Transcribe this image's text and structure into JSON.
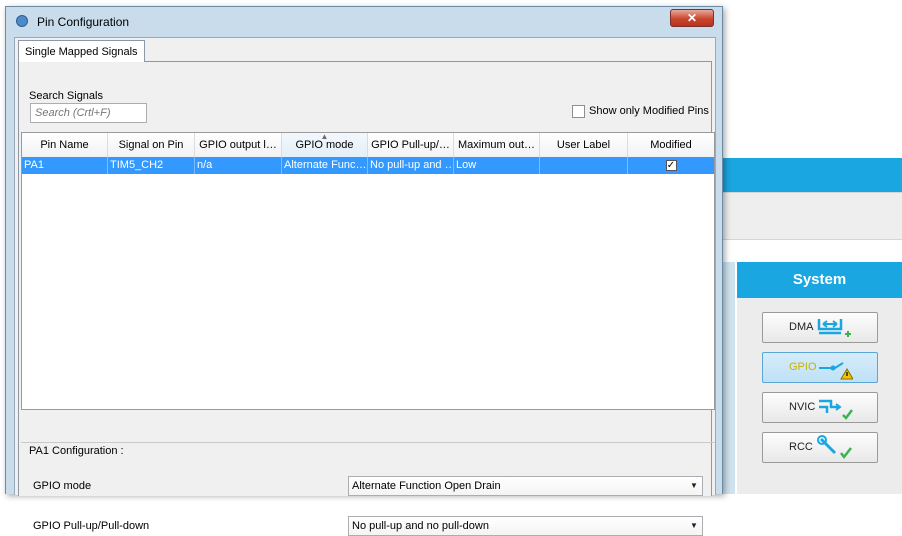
{
  "dialog": {
    "title": "Pin Configuration",
    "close_symbol": "✕",
    "tab_label": "Single Mapped Signals",
    "search_label": "Search Signals",
    "search_placeholder": "Search (Crtl+F)",
    "show_modified_label": "Show only Modified Pins",
    "table": {
      "columns": [
        "Pin Name",
        "Signal on Pin",
        "GPIO output l…",
        "GPIO mode",
        "GPIO Pull-up/…",
        "Maximum out…",
        "User Label",
        "Modified"
      ],
      "sorted_column_index": 3,
      "rows": [
        {
          "pin": "PA1",
          "signal": "TIM5_CH2",
          "output_level": "n/a",
          "mode": "Alternate Func…",
          "pull": "No pull-up and …",
          "max_speed": "Low",
          "user_label": "",
          "modified": "✓"
        }
      ]
    },
    "config": {
      "title": "PA1 Configuration :",
      "gpio_mode_label": "GPIO mode",
      "gpio_mode_value": "Alternate Function Open Drain",
      "pull_label": "GPIO Pull-up/Pull-down",
      "pull_value": "No pull-up and no pull-down"
    }
  },
  "system_panel": {
    "header": "System",
    "buttons": [
      {
        "label": "DMA",
        "icon": "dma-icon"
      },
      {
        "label": "GPIO",
        "icon": "gpio-warning-icon"
      },
      {
        "label": "NVIC",
        "icon": "nvic-check-icon"
      },
      {
        "label": "RCC",
        "icon": "rcc-wrench-check-icon"
      }
    ]
  },
  "colors": {
    "accent_blue": "#1aa6e0",
    "selection": "#3399ff",
    "gpio_text": "#c9b000"
  }
}
